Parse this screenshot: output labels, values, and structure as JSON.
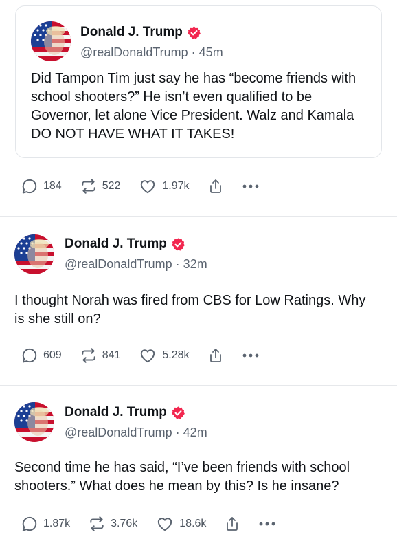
{
  "posts": [
    {
      "author": "Donald J. Trump",
      "handle": "@realDonaldTrump",
      "time": "45m",
      "text": "Did Tampon Tim just say he has “become friends with school shooters?” He isn’t even qualified to be Governor, let alone Vice President. Walz and Kamala DO NOT HAVE WHAT IT TAKES!",
      "replies": "184",
      "reposts": "522",
      "likes": "1.97k"
    },
    {
      "author": "Donald J. Trump",
      "handle": "@realDonaldTrump",
      "time": "32m",
      "text": "I thought Norah was fired from CBS for Low Ratings. Why is she still on?",
      "replies": "609",
      "reposts": "841",
      "likes": "5.28k"
    },
    {
      "author": "Donald J. Trump",
      "handle": "@realDonaldTrump",
      "time": "42m",
      "text": "Second time he has said, “I’ve been friends with school shooters.” What does he mean by this? Is he insane?",
      "replies": "1.87k",
      "reposts": "3.76k",
      "likes": "18.6k"
    }
  ],
  "separator": " · ",
  "colors": {
    "verified": "#f2274f",
    "muted_text": "#5b6470",
    "divider": "#e6e8eb"
  },
  "icons": [
    "reply-icon",
    "repost-icon",
    "like-icon",
    "share-icon",
    "more-icon",
    "verified-badge-icon"
  ]
}
